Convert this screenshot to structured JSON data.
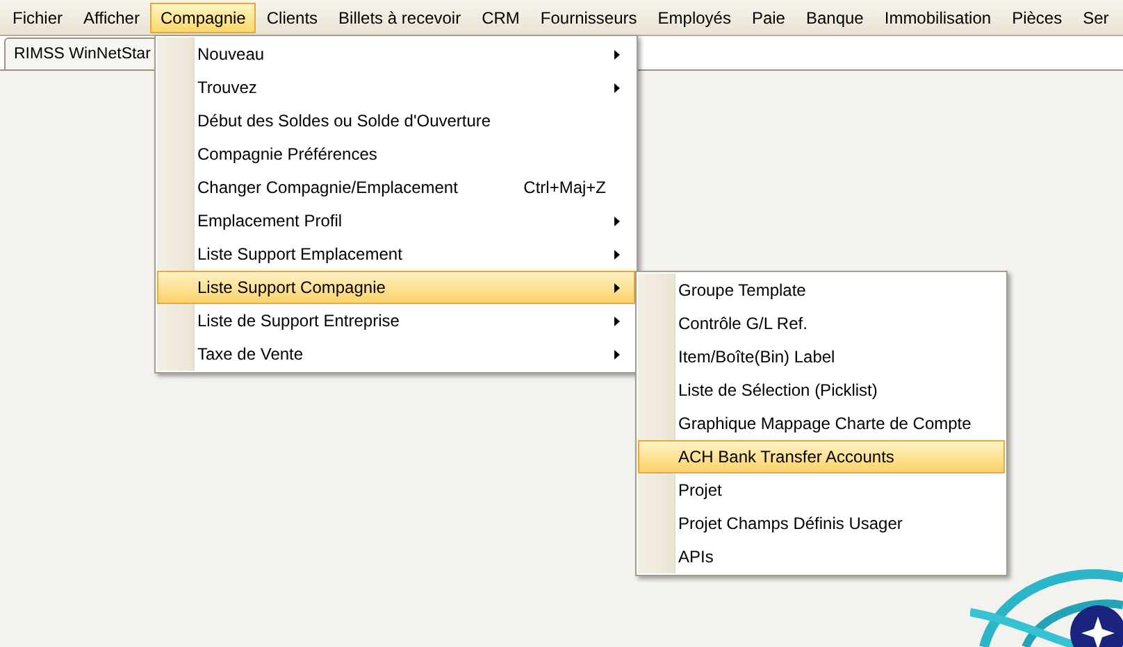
{
  "menu_bar": [
    {
      "label": "Fichier",
      "selected": false
    },
    {
      "label": "Afficher",
      "selected": false
    },
    {
      "label": "Compagnie",
      "selected": true
    },
    {
      "label": "Clients",
      "selected": false
    },
    {
      "label": "Billets à recevoir",
      "selected": false
    },
    {
      "label": "CRM",
      "selected": false
    },
    {
      "label": "Fournisseurs",
      "selected": false
    },
    {
      "label": "Employés",
      "selected": false
    },
    {
      "label": "Paie",
      "selected": false
    },
    {
      "label": "Banque",
      "selected": false
    },
    {
      "label": "Immobilisation",
      "selected": false
    },
    {
      "label": "Pièces",
      "selected": false
    },
    {
      "label": "Ser",
      "selected": false
    }
  ],
  "tabs": [
    {
      "label": "RIMSS WinNetStar",
      "selected": true
    }
  ],
  "menu": {
    "items": [
      {
        "label": "Nouveau",
        "submenu": true,
        "selected": false
      },
      {
        "label": "Trouvez",
        "submenu": true,
        "selected": false
      },
      {
        "label": "Début des Soldes ou Solde d'Ouverture",
        "submenu": false,
        "selected": false
      },
      {
        "label": "Compagnie Préférences",
        "submenu": false,
        "selected": false
      },
      {
        "label": "Changer Compagnie/Emplacement",
        "shortcut": "Ctrl+Maj+Z",
        "submenu": false,
        "selected": false
      },
      {
        "label": "Emplacement Profil",
        "submenu": true,
        "selected": false
      },
      {
        "label": "Liste Support Emplacement",
        "submenu": true,
        "selected": false
      },
      {
        "label": "Liste Support Compagnie",
        "submenu": true,
        "selected": true
      },
      {
        "label": "Liste de Support Entreprise",
        "submenu": true,
        "selected": false
      },
      {
        "label": "Taxe de Vente",
        "submenu": true,
        "selected": false
      }
    ]
  },
  "submenu": {
    "items": [
      {
        "label": "Groupe Template",
        "selected": false
      },
      {
        "label": "Contrôle G/L Ref.",
        "selected": false
      },
      {
        "label": "Item/Boîte(Bin) Label",
        "selected": false
      },
      {
        "label": "Liste de Sélection (Picklist)",
        "selected": false
      },
      {
        "label": "Graphique Mappage Charte de Compte",
        "selected": false
      },
      {
        "label": "ACH Bank Transfer Accounts",
        "selected": true
      },
      {
        "label": "Projet",
        "selected": false
      },
      {
        "label": "Projet Champs Définis Usager",
        "selected": false
      },
      {
        "label": "APIs",
        "selected": false
      }
    ]
  }
}
